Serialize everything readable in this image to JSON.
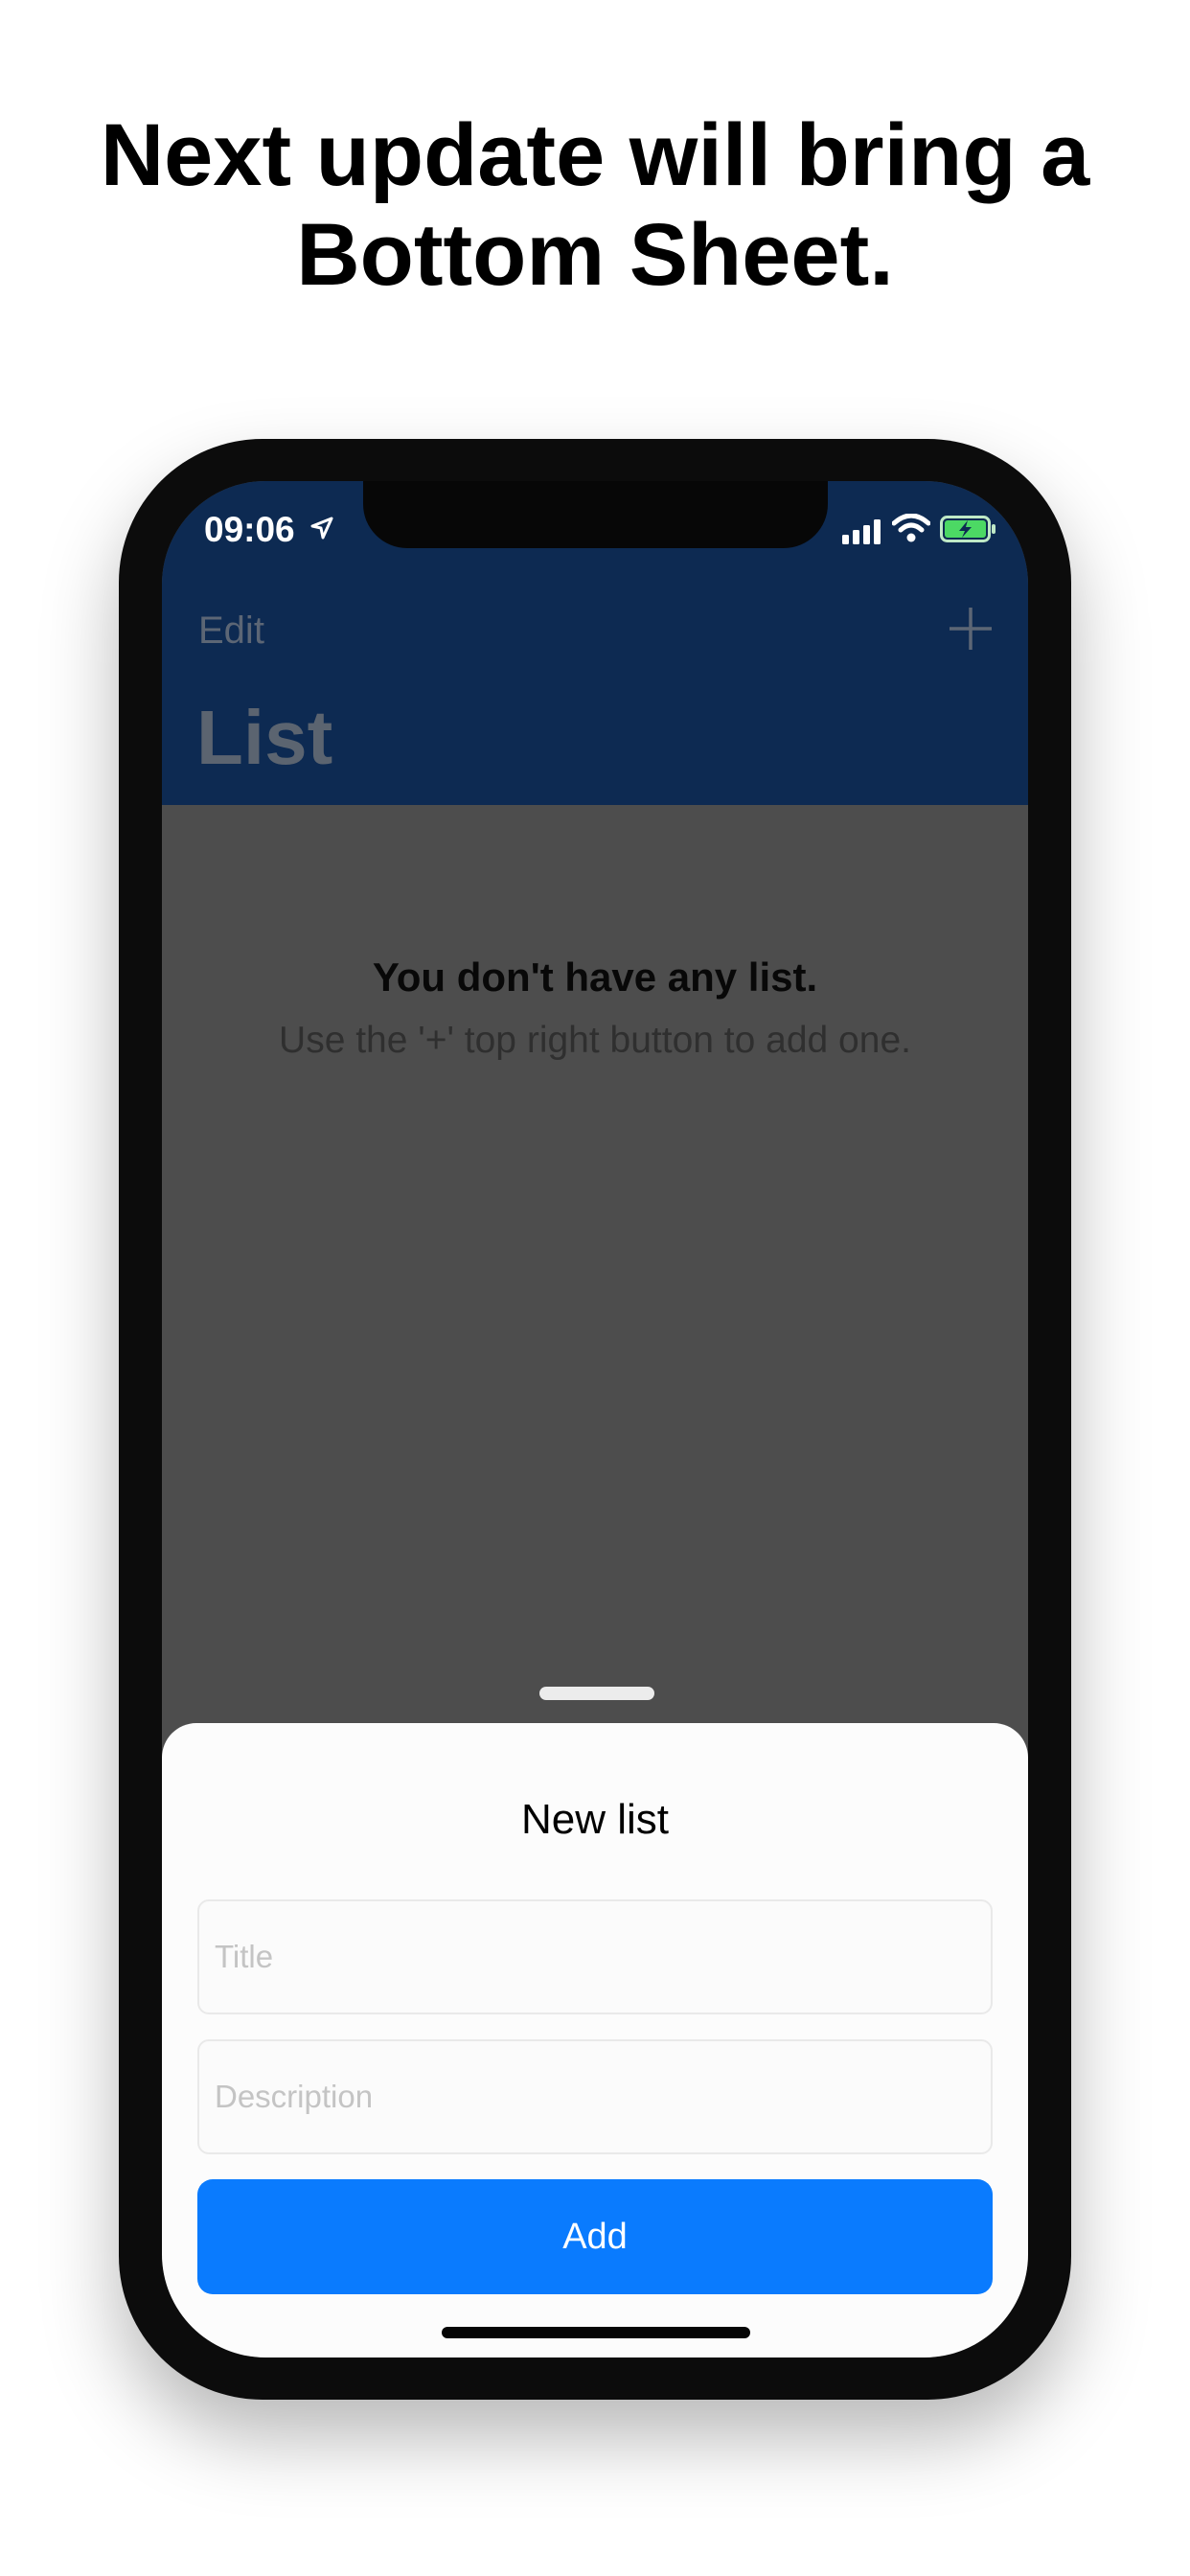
{
  "headline": {
    "line1": "Next update will bring a",
    "line2": "Bottom Sheet."
  },
  "status_bar": {
    "time": "09:06",
    "icons": [
      "location-arrow-icon",
      "cellular-signal-icon",
      "wifi-icon",
      "battery-charging-icon"
    ],
    "battery_color": "#4cd964"
  },
  "nav_bar": {
    "edit_label": "Edit",
    "add_icon": "plus-icon",
    "title": "List",
    "background_color": "#0d2a52"
  },
  "empty_state": {
    "title": "You don't have any list.",
    "subtitle": "Use the '+' top right button to add one."
  },
  "bottom_sheet": {
    "title": "New list",
    "title_placeholder": "Title",
    "description_placeholder": "Description",
    "add_label": "Add",
    "accent_color": "#0a7bfe"
  }
}
